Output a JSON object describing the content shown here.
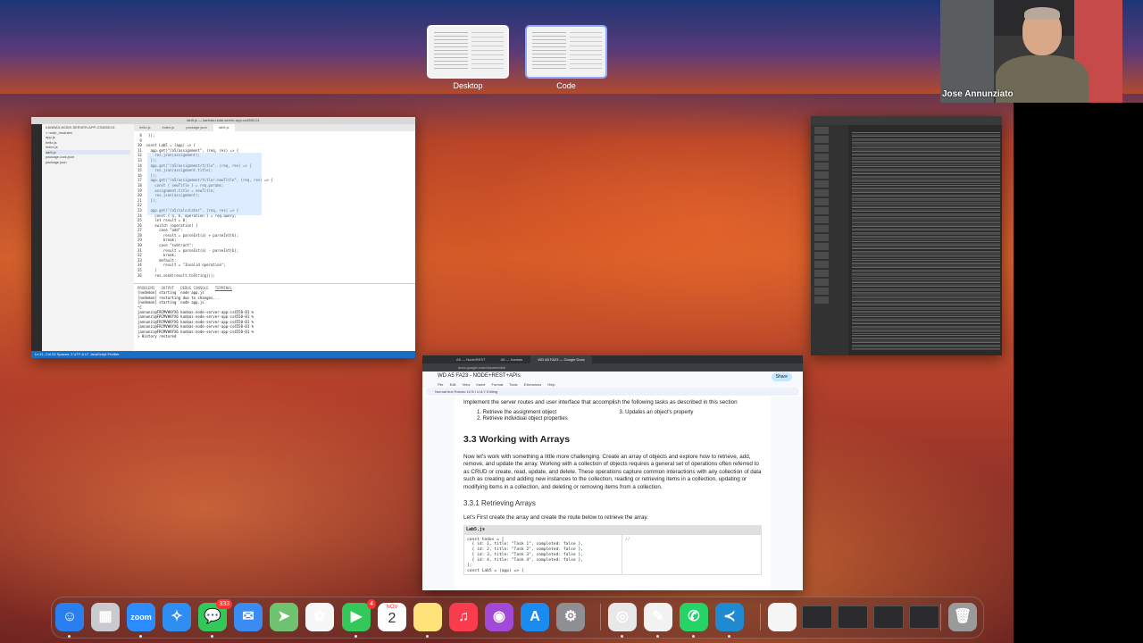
{
  "spaces": [
    {
      "label": "Desktop",
      "active": false
    },
    {
      "label": "Code",
      "active": true
    }
  ],
  "webcam": {
    "name": "Jose Annunziato"
  },
  "vscode": {
    "title": "lab5.js — kanbas-node-server-app-cs4550-01",
    "tabs": [
      "hello.js",
      "index.js",
      "package.json",
      "lab5.js"
    ],
    "sidebar": [
      "KANBAS-NODE-SERVER-APP-CS4550-01",
      "> node_modules",
      "app.js",
      "hello.js",
      "index.js",
      "lab5.js",
      "package-lock.json",
      "package.json"
    ],
    "code": [
      " 8   });",
      " 9",
      "10  const Lab5 = (app) => {",
      "11    app.get(\"/a5/assignment\", (req, res) => {",
      "12      res.json(assignment);",
      "13    });",
      "14    app.get(\"/a5/assignment/title\", (req, res) => {",
      "15      res.json(assignment.title);",
      "16    });",
      "17    app.get(\"/a5/assignment/title/:newTitle\", (req, res) => {",
      "18      const { newTitle } = req.params;",
      "19      assignment.title = newTitle;",
      "20      res.json(assignment);",
      "21    });",
      "22",
      "23    app.get(\"/a5/calculator\", (req, res) => {",
      "24      const { a, b, operation } = req.query;",
      "25      let result = 0;",
      "26      switch (operation) {",
      "27        case \"add\":",
      "28          result = parseInt(a) + parseInt(b);",
      "29          break;",
      "30        case \"subtract\":",
      "31          result = parseInt(a) - parseInt(b);",
      "32          break;",
      "33        default:",
      "34          result = \"Invalid operation\";",
      "35      }",
      "36      res.send(result.toString());"
    ],
    "terminal_tabs": [
      "PROBLEMS",
      "OUTPUT",
      "DEBUG CONSOLE",
      "TERMINAL"
    ],
    "terminal": [
      "[nodemon] starting `node app.js`",
      "[nodemon] restarting due to changes...",
      "[nodemon] starting `node app.js`",
      "^C",
      "",
      "jannunzi@FRCMVWVYX6 kanbas-node-server-app-cs4550-01 %",
      "jannunzi@FRCMVWVYX6 kanbas-node-server-app-cs4550-01 %",
      "jannunzi@FRCMVWVYX6 kanbas-node-server-app-cs4550-01 %",
      "jannunzi@FRCMVWVYX6 kanbas-node-server-app-cs4550-01 %",
      "jannunzi@FRCMVWVYX6 kanbas-node-server-app-cs4550-01 %",
      "> History restored"
    ],
    "status": "Ln 11, Col 23   Spaces: 2   UTF-8   LF   JavaScript   Prettier"
  },
  "docs": {
    "tabs": [
      "A5 — Node/REST",
      "A5 — Kanbas",
      "WD A5 FA23 — Google Docs"
    ],
    "url": "docs.google.com/document/d/",
    "title": "WD A5 FA23 - NODE+REST+APIs",
    "menu": [
      "File",
      "Edit",
      "View",
      "Insert",
      "Format",
      "Tools",
      "Extensions",
      "Help"
    ],
    "toolbar": "Normal text   Roboto   10   B  I  U  A   ≡   Editing",
    "share": "Share",
    "intro": "Implement the server routes and user interface that accomplish the following tasks  as described in this section",
    "list_left": [
      "1.    Retrieve the assignment object",
      "2.    Retrieve individual object properties"
    ],
    "list_right": [
      "3.    Updates an object's property"
    ],
    "h2": "3.3 Working with Arrays",
    "para": "Now let's work with something a little more challenging. Create an array of objects and explore how to retrieve, add, remove, and update the array. Working with a collection of objects requires a general set of operations often referred to as CRUD or create, read, update, and delete. These operations capture common interactions with any collection of data such as creating and adding new instances to the collection, reading or retrieving items in a collection, updating or modifying items in a collection, and deleting or removing items from a collection.",
    "h3": "3.3.1 Retrieving Arrays",
    "para2": "Let's First create the array and create the route below to retrieve the array.",
    "code_file": "Lab5.js",
    "code": [
      "const todos = [",
      "  { id: 1, title: \"Task 1\", completed: false },",
      "  { id: 2, title: \"Task 2\", completed: false },",
      "  { id: 3, title: \"Task 3\", completed: false },",
      "  { id: 4, title: \"Task 4\", completed: false },",
      "];",
      "const Lab5 = (app) => {"
    ],
    "code_comment": "//"
  },
  "dock": {
    "apps": [
      {
        "name": "finder-icon",
        "color": "#2a7ff0",
        "glyph": "☺"
      },
      {
        "name": "launchpad-icon",
        "color": "#c9c9d0",
        "glyph": "▦"
      },
      {
        "name": "zoom-icon",
        "color": "#2d8cff",
        "glyph": "zoom"
      },
      {
        "name": "safari-icon",
        "color": "#2f8ef2",
        "glyph": "✧"
      },
      {
        "name": "messages-icon",
        "color": "#34c759",
        "glyph": "💬",
        "badge": "333"
      },
      {
        "name": "mail-icon",
        "color": "#3b8bf5",
        "glyph": "✉"
      },
      {
        "name": "maps-icon",
        "color": "#6fc270",
        "glyph": "➤"
      },
      {
        "name": "photos-icon",
        "color": "#f7f7f7",
        "glyph": "✿"
      },
      {
        "name": "facetime-icon",
        "color": "#34c759",
        "glyph": "▶",
        "badge": "4"
      },
      {
        "name": "calendar-icon",
        "color": "#ffffff",
        "glyph": "",
        "month": "NOV",
        "day": "2"
      },
      {
        "name": "notes-icon",
        "color": "#ffe27a",
        "glyph": ""
      },
      {
        "name": "music-icon",
        "color": "#fa3c4c",
        "glyph": "♫"
      },
      {
        "name": "podcasts-icon",
        "color": "#a24ad8",
        "glyph": "◉"
      },
      {
        "name": "app-store-icon",
        "color": "#1a8cf0",
        "glyph": "A"
      },
      {
        "name": "system-settings-icon",
        "color": "#8e8e93",
        "glyph": "⚙"
      },
      {
        "name": "chrome-icon",
        "color": "#e8e8e8",
        "glyph": "◎"
      },
      {
        "name": "textedit-icon",
        "color": "#f2f2f2",
        "glyph": "✎"
      },
      {
        "name": "whatsapp-icon",
        "color": "#25d366",
        "glyph": "✆"
      },
      {
        "name": "vscode-icon",
        "color": "#1f8ad2",
        "glyph": "≺"
      },
      {
        "name": "document-icon",
        "color": "#f5f5f5",
        "glyph": ""
      },
      {
        "name": "trash-icon",
        "color": "#9a9a9a",
        "glyph": "🗑"
      }
    ]
  }
}
